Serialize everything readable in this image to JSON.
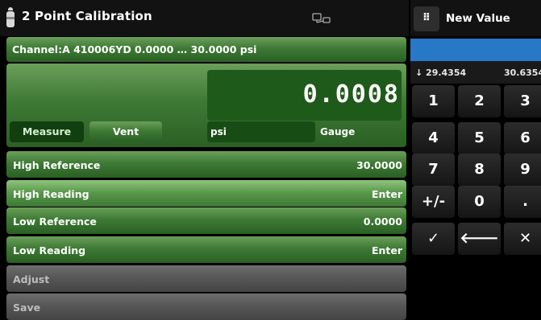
{
  "header": {
    "title": "2 Point Calibration",
    "thermometer_icon": "thermometer-icon",
    "device_icon": "device-link-icon"
  },
  "channel": {
    "label": "Channel:A 410006YD   0.0000 … 30.0000 psi"
  },
  "readout": {
    "value": "0.0008"
  },
  "controls": {
    "measure": "Measure",
    "vent": "Vent",
    "unit": "psi",
    "mode": "Gauge"
  },
  "rows": [
    {
      "label": "High Reference",
      "value": "30.0000"
    },
    {
      "label": "High Reading",
      "value": "Enter"
    },
    {
      "label": "Low Reference",
      "value": "0.0000"
    },
    {
      "label": "Low Reading",
      "value": "Enter"
    },
    {
      "label": "Adjust"
    },
    {
      "label": "Save"
    }
  ],
  "keypad": {
    "title": "New Value",
    "menu_icon": "keypad-grid-icon",
    "input_value": "",
    "range_low": "↓ 29.4354",
    "range_high": "30.6354",
    "keys": [
      "1",
      "2",
      "3",
      "4",
      "5",
      "6",
      "7",
      "8",
      "9",
      "+/-",
      "0",
      ".",
      "✓",
      "🡐",
      "✕"
    ]
  },
  "colors": {
    "accent_green": "#3e7a35",
    "highlight_green": "#5a9a4c",
    "input_blue": "#2878c8",
    "disabled_gray": "#555555"
  }
}
